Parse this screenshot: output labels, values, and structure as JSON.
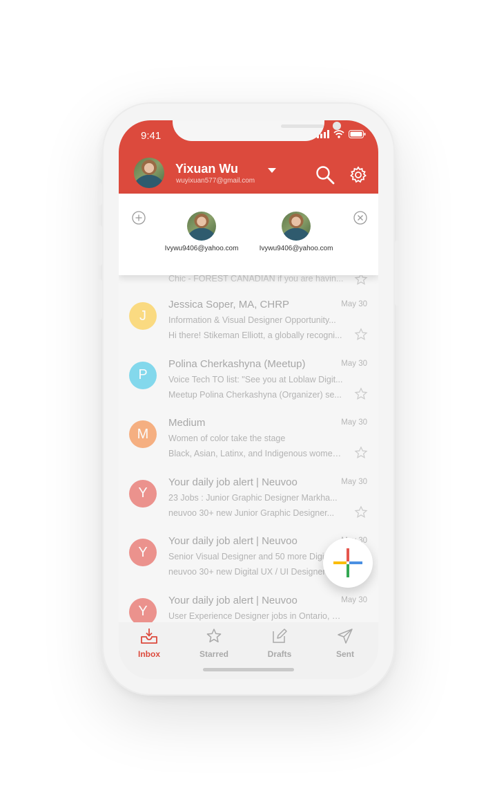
{
  "status": {
    "time": "9:41"
  },
  "account": {
    "name": "Yixuan Wu",
    "email": "wuyixuan577@gmail.com"
  },
  "switcher": {
    "accounts": [
      {
        "email": "Ivywu9406@yahoo.com"
      },
      {
        "email": "Ivywu9406@yahoo.com"
      }
    ]
  },
  "partial_row": {
    "text": "Chic - FOREST CANADIAN if you are havin..."
  },
  "emails": [
    {
      "initial": "J",
      "color": "#fdc93a",
      "sender": "Jessica Soper, MA, CHRP",
      "date": "May 30",
      "subject": "Information & Visual Designer Opportunity...",
      "snippet": "Hi there! Stikeman Elliott, a globally recogni..."
    },
    {
      "initial": "P",
      "color": "#3dc6e6",
      "sender": "Polina Cherkashyna (Meetup)",
      "date": "May 30",
      "subject": "Voice Tech TO list: \"See you at Loblaw Digit...",
      "snippet": "Meetup Polina Cherkashyna (Organizer) se..."
    },
    {
      "initial": "M",
      "color": "#f5843a",
      "sender": "Medium",
      "date": "May 30",
      "subject": "Women of color take the stage",
      "snippet": "Black, Asian, Latinx, and Indigenous women..."
    },
    {
      "initial": "Y",
      "color": "#e5564d",
      "sender": "Your daily job alert | Neuvoo",
      "date": "May 30",
      "subject": "23 Jobs : Junior Graphic Designer Markha...",
      "snippet": "neuvoo 30+ new Junior Graphic Designer..."
    },
    {
      "initial": "Y",
      "color": "#e5564d",
      "sender": "Your daily job alert | Neuvoo",
      "date": "May 30",
      "subject": "Senior Visual Designer and 50 more Digital...",
      "snippet": "neuvoo 30+ new Digital UX / UI Designer o..."
    },
    {
      "initial": "Y",
      "color": "#e5564d",
      "sender": "Your daily job alert | Neuvoo",
      "date": "May 30",
      "subject": "User Experience Designer jobs in Ontario, C...",
      "snippet": ""
    }
  ],
  "tabs": [
    {
      "label": "Inbox",
      "icon": "inbox-icon",
      "active": true
    },
    {
      "label": "Starred",
      "icon": "star-icon",
      "active": false
    },
    {
      "label": "Drafts",
      "icon": "pencil-icon",
      "active": false
    },
    {
      "label": "Sent",
      "icon": "paper-plane-icon",
      "active": false
    }
  ],
  "colors": {
    "accent": "#dc4a3d"
  }
}
